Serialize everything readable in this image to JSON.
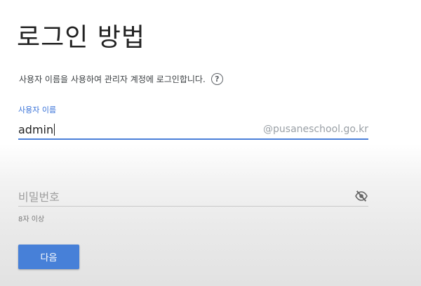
{
  "page": {
    "title": "로그인 방법",
    "description": "사용자 이름을 사용하여 관리자 계정에 로그인합니다.",
    "help_icon": "help-circle-icon"
  },
  "username": {
    "label": "사용자 이름",
    "value": "admin",
    "domain_suffix": "@pusaneschool.go.kr"
  },
  "password": {
    "placeholder": "비밀번호",
    "visibility_icon": "eye-off-icon",
    "hint": "8자 이상"
  },
  "actions": {
    "next_label": "다음"
  },
  "colors": {
    "accent": "#4780d8",
    "label_active": "#3a73d8"
  }
}
